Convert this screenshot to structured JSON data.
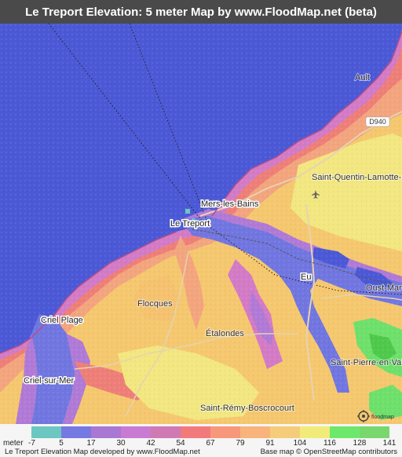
{
  "title": "Le Treport Elevation: 5 meter Map by www.FloodMap.net (beta)",
  "map": {
    "places": [
      {
        "id": "ault",
        "label": "Ault"
      },
      {
        "id": "mers",
        "label": "Mers-les-Bains"
      },
      {
        "id": "treport",
        "label": "Le Treport"
      },
      {
        "id": "saint-quentin",
        "label": "Saint-Quentin-Lamotte-Cr"
      },
      {
        "id": "eu",
        "label": "Eu"
      },
      {
        "id": "oust-marest",
        "label": "Oust-Mare"
      },
      {
        "id": "flocques",
        "label": "Flocques"
      },
      {
        "id": "etalondes",
        "label": "Étalondes"
      },
      {
        "id": "criel-plage",
        "label": "Criel Plage"
      },
      {
        "id": "criel-sur-mer",
        "label": "Criel-sur-Mer"
      },
      {
        "id": "saint-pierre",
        "label": "Saint-Pierre-en-Val"
      },
      {
        "id": "saint-remy",
        "label": "Saint-Rémy-Boscrocourt"
      }
    ],
    "road_labels": [
      {
        "id": "d940",
        "label": "D940"
      }
    ],
    "colors": {
      "sea": "#4c59d6",
      "low": "#7176e0",
      "violet": "#b07ad6",
      "magenta": "#d37bc6",
      "red": "#f08074",
      "orange": "#f7a67c",
      "tan": "#f5c26f",
      "yellow": "#f2e780",
      "green": "#6ee06b",
      "darkgreen": "#4fc94b"
    },
    "logo_text": "floodmap"
  },
  "legend": {
    "unit_label": "meter",
    "values": [
      "-7",
      "5",
      "17",
      "30",
      "42",
      "54",
      "67",
      "79",
      "91",
      "104",
      "116",
      "128",
      "141"
    ],
    "colors": [
      "#6cc7c2",
      "#7679e2",
      "#a978d4",
      "#c97bd4",
      "#d07ab4",
      "#f37a7a",
      "#f7987a",
      "#f8b47a",
      "#f5cd7a",
      "#f1ec7a",
      "#6ee86b",
      "#78d86e"
    ]
  },
  "footer": {
    "left": "Le Treport Elevation Map developed by www.FloodMap.net",
    "right": "Base map © OpenStreetMap contributors"
  }
}
